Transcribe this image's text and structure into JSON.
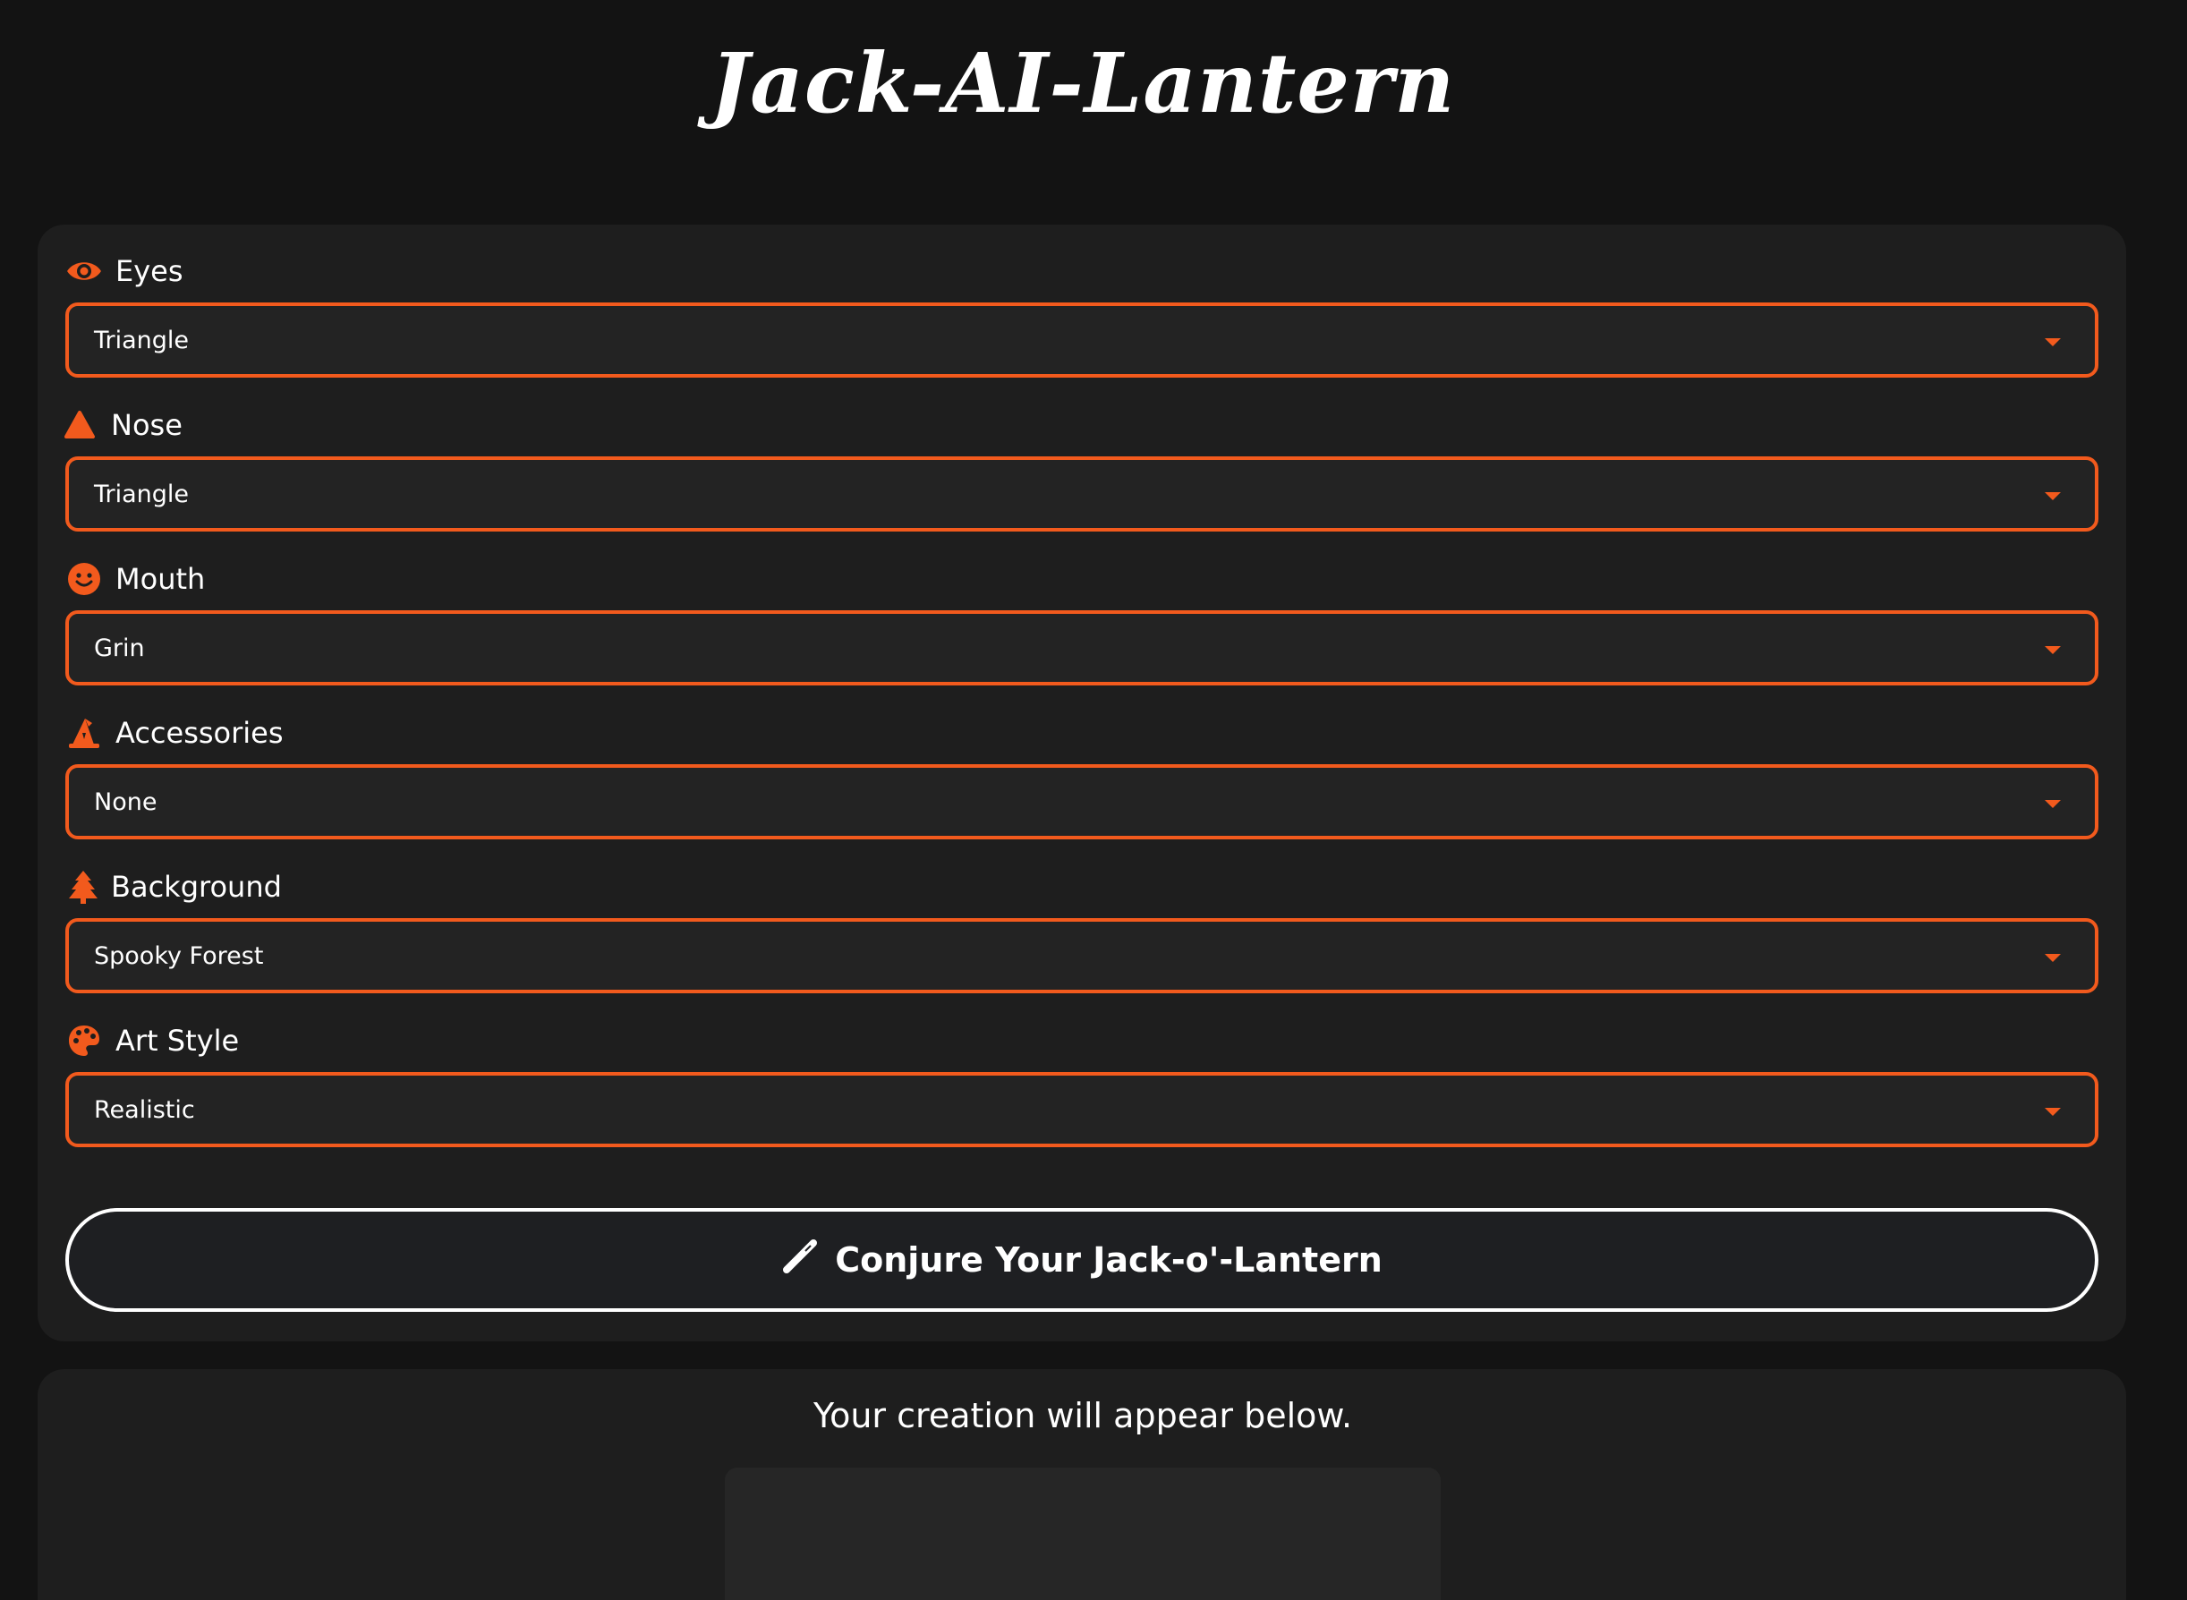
{
  "app": {
    "title": "Jack-AI-Lantern"
  },
  "form": {
    "fields": [
      {
        "label": "Eyes",
        "icon": "eye-icon",
        "value": "Triangle"
      },
      {
        "label": "Nose",
        "icon": "triangle-icon",
        "value": "Triangle"
      },
      {
        "label": "Mouth",
        "icon": "smile-icon",
        "value": "Grin"
      },
      {
        "label": "Accessories",
        "icon": "witch-hat-icon",
        "value": "None"
      },
      {
        "label": "Background",
        "icon": "tree-icon",
        "value": "Spooky Forest"
      },
      {
        "label": "Art Style",
        "icon": "palette-icon",
        "value": "Realistic"
      }
    ],
    "submit_label": "Conjure Your Jack-o'-Lantern",
    "submit_icon": "magic-wand-icon"
  },
  "result": {
    "message": "Your creation will appear below."
  },
  "colors": {
    "accent": "#f25a1d",
    "background": "#131313",
    "panel": "#1e1e1e"
  }
}
